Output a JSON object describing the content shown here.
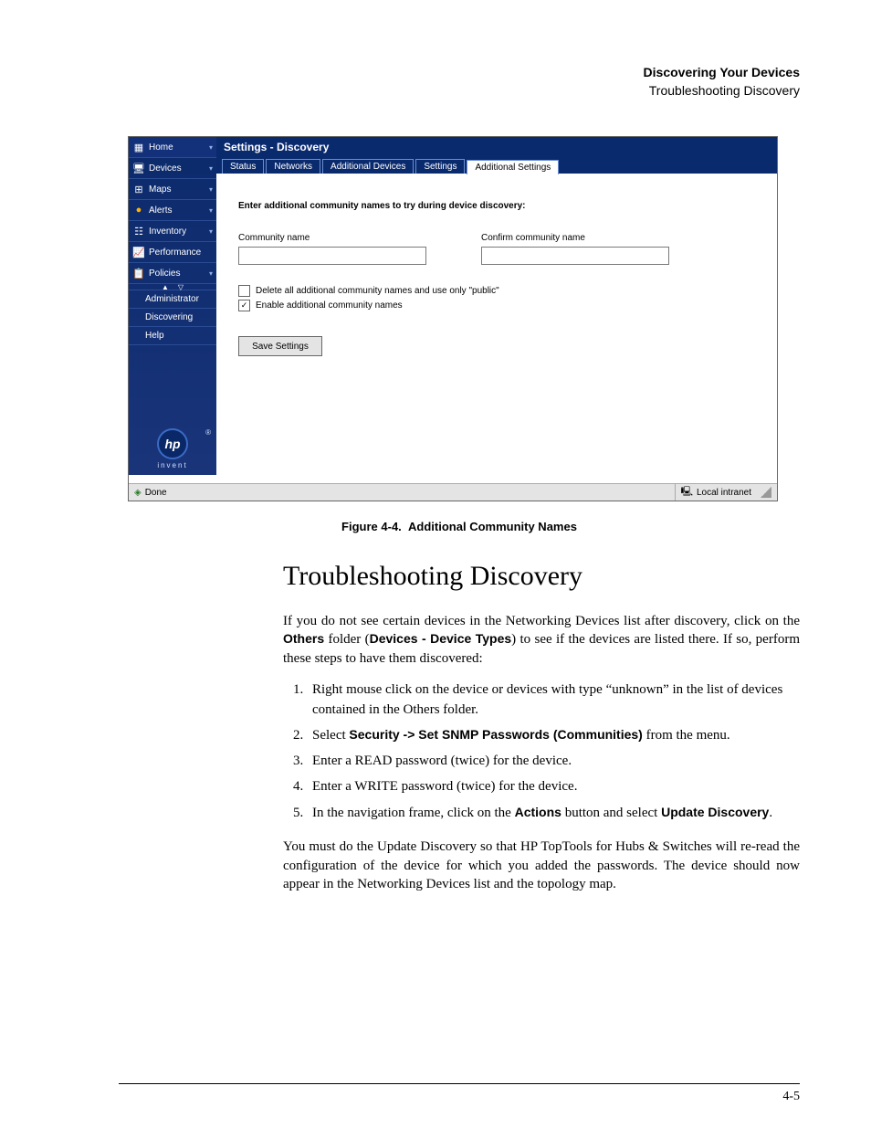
{
  "header": {
    "chapter": "Discovering Your Devices",
    "section": "Troubleshooting Discovery"
  },
  "screenshot": {
    "title": "Settings - Discovery",
    "sidebar": {
      "items": [
        {
          "label": "Home",
          "icon_name": "grid"
        },
        {
          "label": "Devices",
          "icon_name": "devices"
        },
        {
          "label": "Maps",
          "icon_name": "maps"
        },
        {
          "label": "Alerts",
          "icon_name": "alert"
        },
        {
          "label": "Inventory",
          "icon_name": "inventory"
        },
        {
          "label": "Performance",
          "icon_name": "perf"
        },
        {
          "label": "Policies",
          "icon_name": "policies"
        }
      ],
      "sub": [
        {
          "label": "Administrator",
          "icon_name": "admin"
        },
        {
          "label": "Discovering",
          "icon_name": "discover"
        },
        {
          "label": "Help",
          "icon_name": "help"
        }
      ],
      "brand": "hp",
      "tagline": "invent"
    },
    "tabs": [
      "Status",
      "Networks",
      "Additional Devices",
      "Settings",
      "Additional Settings"
    ],
    "active_tab_index": 4,
    "form": {
      "lead": "Enter additional community names to try during device discovery:",
      "field1_label": "Community name",
      "field1_value": "",
      "field2_label": "Confirm community name",
      "field2_value": "",
      "check1": "Delete all additional community names and use only \"public\"",
      "check1_checked": false,
      "check2": "Enable additional community names",
      "check2_checked": true,
      "button": "Save Settings"
    },
    "status": {
      "left": "Done",
      "right": "Local intranet"
    }
  },
  "caption": {
    "label": "Figure 4-4.",
    "title": "Additional Community Names"
  },
  "body": {
    "heading": "Troubleshooting Discovery",
    "intro_a": "If you do not see certain devices in the Networking Devices list after discovery, click on the ",
    "intro_b1": "Others",
    "intro_c": " folder (",
    "intro_b2": "Devices - Device Types",
    "intro_d": ") to see if the devices are listed there. If so, perform these steps to have them discovered:",
    "steps": [
      {
        "pre": "Right mouse click on the device or devices with type “unknown” in the list of devices contained in the Others folder."
      },
      {
        "pre": "Select ",
        "b": "Security -> Set SNMP Passwords (Communities)",
        "post": " from the menu."
      },
      {
        "pre": "Enter a READ password (twice) for the device."
      },
      {
        "pre": "Enter a WRITE password (twice) for the device."
      },
      {
        "pre": "In the navigation frame, click on the ",
        "b": "Actions",
        "mid": " button and select ",
        "b2": "Update Discovery",
        "post": "."
      }
    ],
    "outro": "You must do the Update Discovery so that HP TopTools for Hubs & Switches will re-read the configuration of the device for which you added the pass­words. The device should now appear in the Networking Devices list and the topology map."
  },
  "page_number": "4-5"
}
